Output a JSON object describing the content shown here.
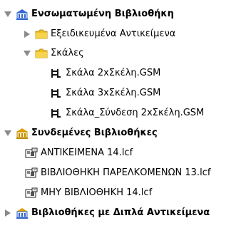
{
  "tree": {
    "embedded_library": {
      "label": "Ενσωματωμένη Βιβλιοθήκη",
      "expanded": true,
      "children": {
        "special_objects": {
          "label": "Εξειδικευμένα Αντικείμενα",
          "expanded": false
        },
        "stairs": {
          "label": "Σκάλες",
          "expanded": true,
          "items": [
            {
              "label": "Σκάλα 2xΣκέλη.GSM"
            },
            {
              "label": "Σκάλα 3xΣκέλη.GSM"
            },
            {
              "label": "Σκάλα_Σύνδεση 2xΣκέλη.GSM"
            }
          ]
        }
      }
    },
    "linked_libraries": {
      "label": "Συνδεμένες Βιβλιοθήκες",
      "expanded": true,
      "items": [
        {
          "label": "ΑΝΤΙΚΕΙΜΕΝΑ 14.lcf"
        },
        {
          "label": "ΒΙΒΛΙΟΘΗΚΗ ΠΑΡΕΛΚΟΜΕΝΩΝ 13.lcf"
        },
        {
          "label": "ΜΗΥ ΒΙΒΛΙΟΘΗΚΗ 14.lcf"
        }
      ]
    },
    "duplicate_libraries": {
      "label": "Βιβλιοθήκες με Διπλά Αντικείμενα",
      "expanded": false
    }
  },
  "colors": {
    "folder": "#f0c020",
    "folder_edge": "#b8901a",
    "library_blue": "#3366cc",
    "library_gold": "#e0a000",
    "disclosure": "#8a8a8a"
  },
  "icons": {
    "expanded": "triangle-down-icon",
    "collapsed": "triangle-right-icon",
    "library": "library-building-icon",
    "folder": "folder-icon",
    "gsm": "stair-object-icon",
    "lcf": "lcf-container-icon"
  }
}
